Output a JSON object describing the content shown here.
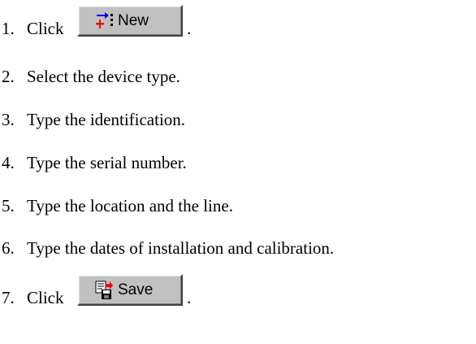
{
  "steps": [
    {
      "number": "1.",
      "text": "Click",
      "button": {
        "label": "New",
        "icon": "new-device-icon"
      },
      "suffix": "."
    },
    {
      "number": "2.",
      "text": "Select the device type."
    },
    {
      "number": "3.",
      "text": "Type the identification."
    },
    {
      "number": "4.",
      "text": "Type the serial number."
    },
    {
      "number": "5.",
      "text": "Type the location and the line."
    },
    {
      "number": "6.",
      "text": "Type the dates of installation and calibration."
    },
    {
      "number": "7.",
      "text": "Click",
      "button": {
        "label": "Save",
        "icon": "save-icon"
      },
      "suffix": "."
    }
  ],
  "colors": {
    "button_face": "#c0c0c0",
    "icon_red": "#ff0000",
    "icon_blue": "#0000ff",
    "icon_black": "#000000"
  }
}
